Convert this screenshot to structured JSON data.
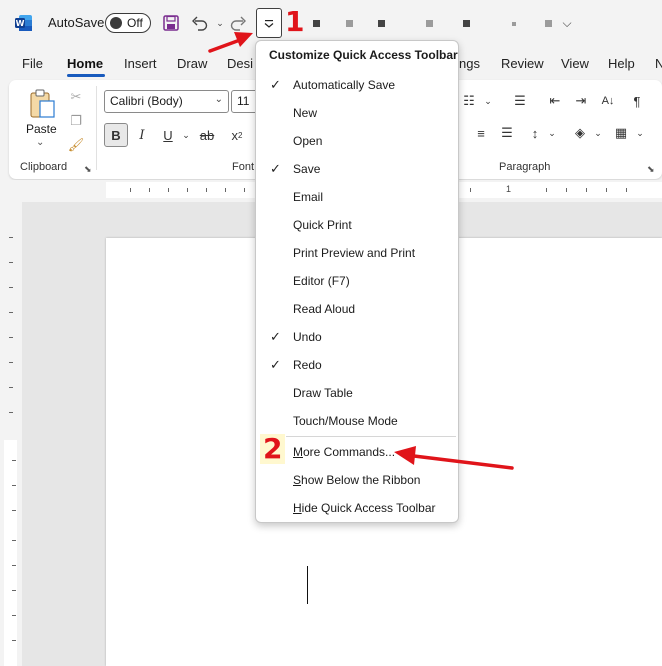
{
  "titlebar": {
    "autosave_label": "AutoSave",
    "autosave_state": "Off",
    "icons": [
      "word-logo-icon",
      "save-icon",
      "undo-icon",
      "redo-icon",
      "qat-customize-icon"
    ]
  },
  "tabs": [
    {
      "label": "File"
    },
    {
      "label": "Home",
      "active": true
    },
    {
      "label": "Insert"
    },
    {
      "label": "Draw"
    },
    {
      "label": "Desi"
    },
    {
      "label": "ngs"
    },
    {
      "label": "Review"
    },
    {
      "label": "View"
    },
    {
      "label": "Help"
    },
    {
      "label": "N"
    }
  ],
  "ribbon": {
    "paste_label": "Paste",
    "clipboard_label": "Clipboard",
    "font_name": "Calibri (Body)",
    "font_size": "11",
    "font_group_label": "Font",
    "bold": "B",
    "italic": "I",
    "underline": "U",
    "strike": "ab",
    "subscript": "x",
    "paragraph_label": "Paragraph"
  },
  "ruler": {
    "number": "1"
  },
  "menu": {
    "title": "Customize Quick Access Toolbar",
    "items": [
      {
        "label": "Automatically Save",
        "checked": true
      },
      {
        "label": "New",
        "checked": false
      },
      {
        "label": "Open",
        "checked": false
      },
      {
        "label": "Save",
        "checked": true
      },
      {
        "label": "Email",
        "checked": false
      },
      {
        "label": "Quick Print",
        "checked": false
      },
      {
        "label": "Print Preview and Print",
        "checked": false
      },
      {
        "label": "Editor (F7)",
        "checked": false
      },
      {
        "label": "Read Aloud",
        "checked": false
      },
      {
        "label": "Undo",
        "checked": true
      },
      {
        "label": "Redo",
        "checked": true
      },
      {
        "label": "Draw Table",
        "checked": false
      },
      {
        "label": "Touch/Mouse Mode",
        "checked": false
      }
    ],
    "more_commands": "More Commands...",
    "show_below": "Show Below the Ribbon",
    "hide_qat": "Hide Quick Access Toolbar",
    "check_glyph": "✓"
  },
  "annotations": {
    "step1": "1",
    "step2": "2"
  },
  "colors": {
    "accent": "#185abd",
    "annotation": "#e0141a",
    "word_blue": "#185abd"
  }
}
